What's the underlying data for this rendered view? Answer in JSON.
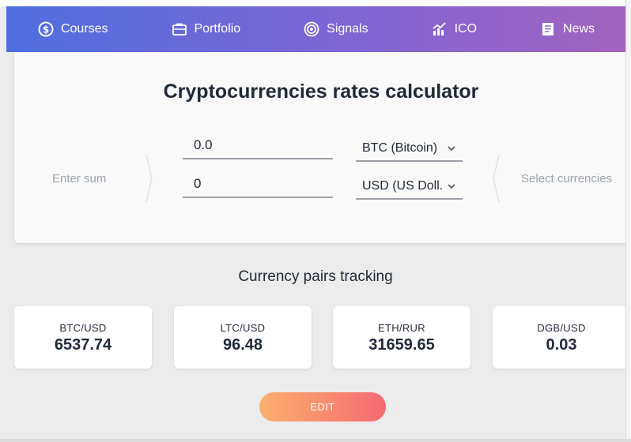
{
  "nav": {
    "items": [
      {
        "label": "Courses",
        "icon": "dollar-circle-icon"
      },
      {
        "label": "Portfolio",
        "icon": "briefcase-icon"
      },
      {
        "label": "Signals",
        "icon": "target-icon"
      },
      {
        "label": "ICO",
        "icon": "chart-icon"
      },
      {
        "label": "News",
        "icon": "newspaper-icon"
      }
    ]
  },
  "calculator": {
    "title": "Cryptocurrencies rates calculator",
    "left_label": "Enter sum",
    "right_label": "Select currencies",
    "amount_from": "0.0",
    "amount_to": "0",
    "currency_from": "BTC (Bitcoin)",
    "currency_to": "USD (US Doll..."
  },
  "tracking": {
    "title": "Currency pairs tracking",
    "pairs": [
      {
        "name": "BTC/USD",
        "value": "6537.74"
      },
      {
        "name": "LTC/USD",
        "value": "96.48"
      },
      {
        "name": "ETH/RUR",
        "value": "31659.65"
      },
      {
        "name": "DGB/USD",
        "value": "0.03"
      }
    ],
    "edit_label": "EDIT"
  },
  "colors": {
    "nav_gradient": [
      "#4f6fe0",
      "#a263bf"
    ],
    "edit_gradient": [
      "#fbb06d",
      "#f66a72"
    ]
  }
}
